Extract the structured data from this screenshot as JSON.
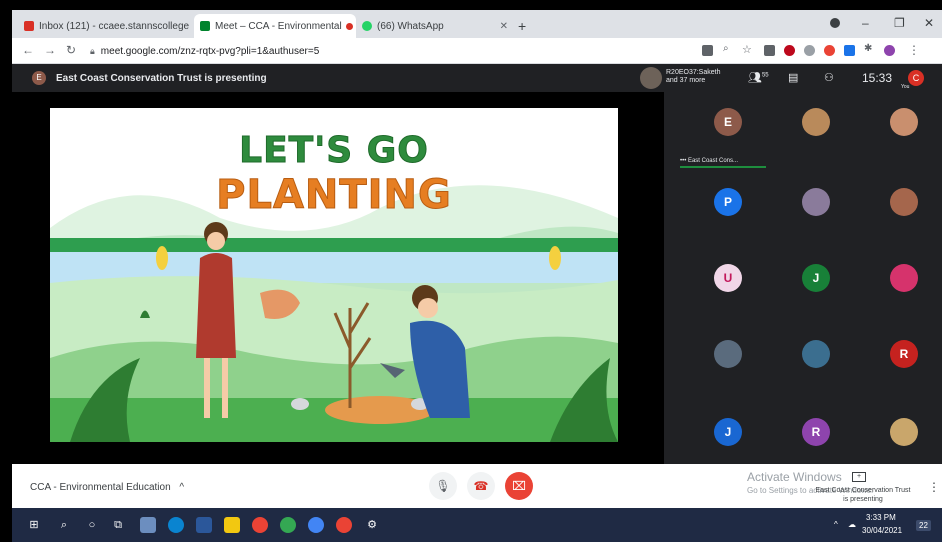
{
  "browser": {
    "tabs": [
      {
        "label": "Inbox (121) - ccaee.stannscollege",
        "icon": "gmail-icon",
        "color": "#d93025"
      },
      {
        "label": "Meet – CCA - Environmental",
        "icon": "meet-icon",
        "color": "#00832d"
      },
      {
        "label": "(66) WhatsApp",
        "icon": "whatsapp-icon",
        "color": "#25d366"
      }
    ],
    "tab_close": "✕",
    "new_tab": "+",
    "window_controls": {
      "minimize": "–",
      "maximize": "❐",
      "close": "✕"
    },
    "url": "meet.google.com/znz-rqtx-pvg?pli=1&authuser=5"
  },
  "meet": {
    "presenter_initial": "E",
    "presenting_text": "East Coast Conservation Trust is presenting",
    "header_participant": "R20EO37:Saketh",
    "header_more": "and 37 more",
    "participant_count": "55",
    "time": "15:33",
    "self_initial": "C",
    "self_label": "You"
  },
  "slide": {
    "title_line1": "LET'S GO",
    "title_line2": "PLANTING"
  },
  "participants": [
    {
      "initial": "E",
      "color": "#8d5a4a",
      "label": "East Coast Cons..."
    },
    {
      "initial": "",
      "color": "#b98a5b"
    },
    {
      "initial": "",
      "color": "#c98f6e"
    },
    {
      "initial": "P",
      "color": "#1a73e8"
    },
    {
      "initial": "",
      "color": "#8a7b9b"
    },
    {
      "initial": "",
      "color": "#a5664c"
    },
    {
      "initial": "U",
      "color": "#f1d7e8"
    },
    {
      "initial": "J",
      "color": "#188038"
    },
    {
      "initial": "",
      "color": "#d6336c"
    },
    {
      "initial": "",
      "color": "#5a6b7d"
    },
    {
      "initial": "",
      "color": "#3b6e8f"
    },
    {
      "initial": "R",
      "color": "#c5221f"
    },
    {
      "initial": "J",
      "color": "#1967d2"
    },
    {
      "initial": "R",
      "color": "#8e44ad"
    },
    {
      "initial": "",
      "color": "#c9a66b"
    }
  ],
  "participant_label": "••• East Coast Cons...",
  "bottom": {
    "meeting_name": "CCA - Environmental Education",
    "caret": "^",
    "watermark_title": "Activate Windows",
    "watermark_sub": "Go to Settings to activate Windows.",
    "presenting_line1": "East Coast Conservation Trust",
    "presenting_line2": "is presenting"
  },
  "taskbar": {
    "time": "3:33 PM",
    "date": "30/04/2021",
    "notification_count": "22"
  },
  "colors": {
    "accent_red": "#ea4335",
    "meet_dark": "#202124",
    "taskbar": "#1f2a44"
  }
}
